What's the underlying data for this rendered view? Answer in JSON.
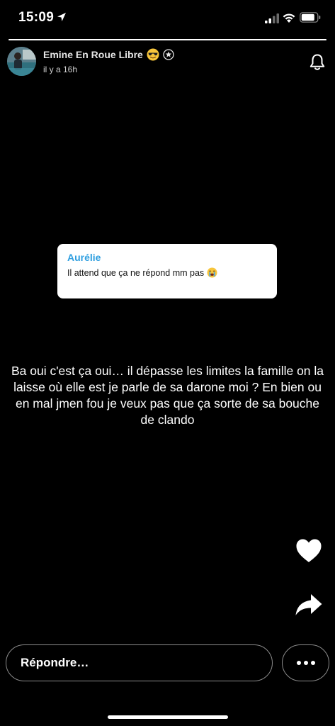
{
  "status_bar": {
    "time": "15:09",
    "icons": [
      "location-arrow-icon",
      "cellular-signal-icon",
      "wifi-icon",
      "battery-icon"
    ]
  },
  "story": {
    "progress": 1.0,
    "author": {
      "name": "Emine En Roue Libre",
      "emoji": "smiling-face-with-sunglasses",
      "badge": "star-badge-icon"
    },
    "timestamp": "il y a 16h",
    "quoted_reply": {
      "name": "Aurélie",
      "text": "Il attend que ça ne répond mm pas",
      "emoji": "loudly-crying-face",
      "name_color": "#2f9fe0"
    },
    "text": "Ba oui c'est ça oui… il dépasse les limites la famille on la laisse où elle est je parle de sa darone moi ? En bien ou en mal jmen fou je veux pas que ça sorte de sa bouche de clando"
  },
  "actions": {
    "like": "heart-icon",
    "share": "share-arrow-icon",
    "notifications": "bell-icon"
  },
  "composer": {
    "placeholder": "Répondre…",
    "more": "more-options"
  },
  "colors": {
    "background": "#000000",
    "accent": "#2f9fe0",
    "text": "#ffffff"
  }
}
